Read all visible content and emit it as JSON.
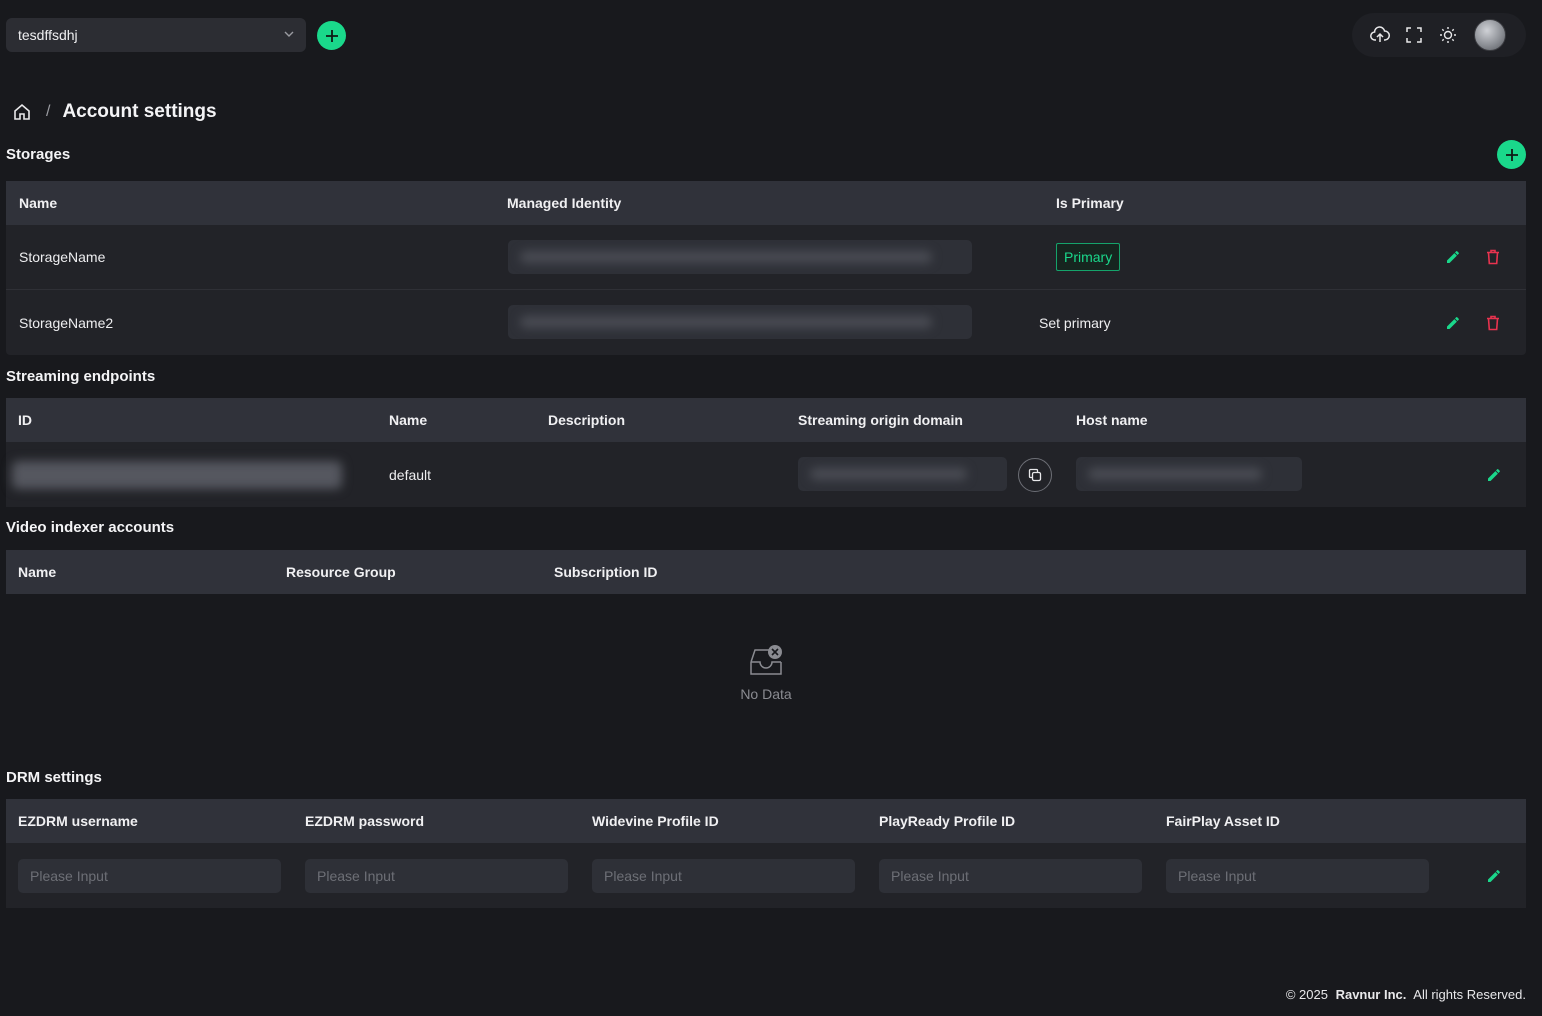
{
  "header": {
    "account_selector": "tesdffsdhj",
    "icons": [
      "upload-cloud-icon",
      "fullscreen-icon",
      "theme-sun-icon",
      "avatar"
    ]
  },
  "breadcrumb": {
    "separator": "/",
    "title": "Account settings"
  },
  "storages": {
    "title": "Storages",
    "columns": [
      "Name",
      "Managed Identity",
      "Is Primary"
    ],
    "rows": [
      {
        "name": "StorageName",
        "is_primary": "Primary"
      },
      {
        "name": "StorageName2",
        "is_primary": "Set primary"
      }
    ]
  },
  "streaming": {
    "title": "Streaming endpoints",
    "columns": [
      "ID",
      "Name",
      "Description",
      "Streaming origin domain",
      "Host name"
    ],
    "rows": [
      {
        "name": "default",
        "description": ""
      }
    ]
  },
  "indexer": {
    "title": "Video indexer accounts",
    "columns": [
      "Name",
      "Resource Group",
      "Subscription ID"
    ],
    "empty_text": "No Data"
  },
  "drm": {
    "title": "DRM settings",
    "columns": [
      "EZDRM username",
      "EZDRM password",
      "Widevine Profile ID",
      "PlayReady Profile ID",
      "FairPlay Asset ID"
    ],
    "placeholder": "Please Input"
  },
  "footer": {
    "copyright": "© 2025",
    "company": "Ravnur Inc.",
    "rights": "All rights Reserved."
  },
  "colors": {
    "accent": "#1ad88b",
    "danger": "#e8334f",
    "background": "#18191d",
    "table_header": "#30323a"
  }
}
